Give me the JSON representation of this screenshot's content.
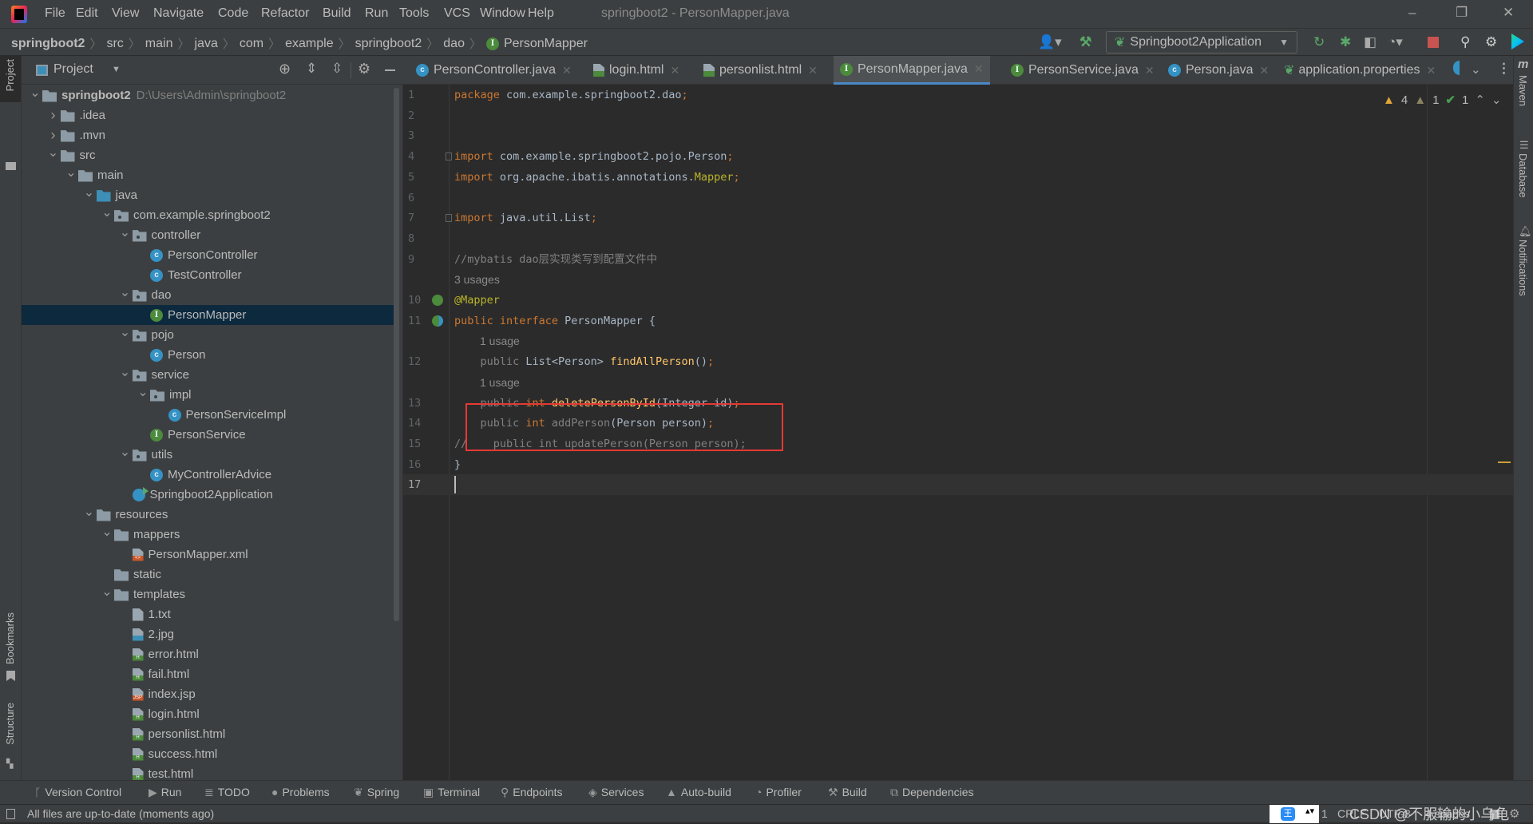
{
  "window": {
    "title": "springboot2 - PersonMapper.java",
    "menu": [
      "File",
      "Edit",
      "View",
      "Navigate",
      "Code",
      "Refactor",
      "Build",
      "Run",
      "Tools",
      "VCS",
      "Window",
      "Help"
    ],
    "controls": {
      "minimize": "–",
      "restore": "❐",
      "close": "✕"
    }
  },
  "breadcrumb": {
    "items": [
      "springboot2",
      "src",
      "main",
      "java",
      "com",
      "example",
      "springboot2",
      "dao"
    ],
    "current": "PersonMapper",
    "current_icon": "interface-icon"
  },
  "toolbar": {
    "run_config": "Springboot2Application",
    "icons": [
      "user-icon",
      "build-hammer-icon",
      "rerun-icon",
      "debug-icon",
      "coverage-icon",
      "profile-icon",
      "stop-icon",
      "search-icon",
      "settings-icon",
      "toolbox-icon"
    ],
    "stop_color": "#c75450"
  },
  "left_stripe": {
    "project": "Project",
    "bookmarks": "Bookmarks",
    "structure": "Structure"
  },
  "right_stripe": {
    "maven": "Maven",
    "database": "Database",
    "notifications": "Notifications"
  },
  "project_panel": {
    "title": "Project",
    "tree": [
      {
        "label": "springboot2",
        "path": "D:\\Users\\Admin\\springboot2",
        "depth": 0,
        "icon": "module",
        "state": "expanded",
        "bold": true
      },
      {
        "label": ".idea",
        "depth": 1,
        "icon": "folder",
        "state": "collapsed"
      },
      {
        "label": ".mvn",
        "depth": 1,
        "icon": "folder",
        "state": "collapsed"
      },
      {
        "label": "src",
        "depth": 1,
        "icon": "folder",
        "state": "expanded"
      },
      {
        "label": "main",
        "depth": 2,
        "icon": "folder",
        "state": "expanded"
      },
      {
        "label": "java",
        "depth": 3,
        "icon": "source-folder",
        "state": "expanded"
      },
      {
        "label": "com.example.springboot2",
        "depth": 4,
        "icon": "package",
        "state": "expanded"
      },
      {
        "label": "controller",
        "depth": 5,
        "icon": "package",
        "state": "expanded"
      },
      {
        "label": "PersonController",
        "depth": 6,
        "icon": "class",
        "state": "leaf"
      },
      {
        "label": "TestController",
        "depth": 6,
        "icon": "class",
        "state": "leaf"
      },
      {
        "label": "dao",
        "depth": 5,
        "icon": "package",
        "state": "expanded"
      },
      {
        "label": "PersonMapper",
        "depth": 6,
        "icon": "interface",
        "state": "leaf",
        "selected": true
      },
      {
        "label": "pojo",
        "depth": 5,
        "icon": "package",
        "state": "expanded"
      },
      {
        "label": "Person",
        "depth": 6,
        "icon": "class",
        "state": "leaf"
      },
      {
        "label": "service",
        "depth": 5,
        "icon": "package",
        "state": "expanded"
      },
      {
        "label": "impl",
        "depth": 6,
        "icon": "package",
        "state": "expanded"
      },
      {
        "label": "PersonServiceImpl",
        "depth": 7,
        "icon": "class",
        "state": "leaf"
      },
      {
        "label": "PersonService",
        "depth": 6,
        "icon": "interface",
        "state": "leaf"
      },
      {
        "label": "utils",
        "depth": 5,
        "icon": "package",
        "state": "expanded"
      },
      {
        "label": "MyControllerAdvice",
        "depth": 6,
        "icon": "class",
        "state": "leaf"
      },
      {
        "label": "Springboot2Application",
        "depth": 5,
        "icon": "spring-boot",
        "state": "leaf"
      },
      {
        "label": "resources",
        "depth": 3,
        "icon": "resources-folder",
        "state": "expanded"
      },
      {
        "label": "mappers",
        "depth": 4,
        "icon": "folder",
        "state": "expanded"
      },
      {
        "label": "PersonMapper.xml",
        "depth": 5,
        "icon": "xml",
        "state": "leaf"
      },
      {
        "label": "static",
        "depth": 4,
        "icon": "folder",
        "state": "leaf"
      },
      {
        "label": "templates",
        "depth": 4,
        "icon": "folder",
        "state": "expanded"
      },
      {
        "label": "1.txt",
        "depth": 5,
        "icon": "text",
        "state": "leaf"
      },
      {
        "label": "2.jpg",
        "depth": 5,
        "icon": "image",
        "state": "leaf"
      },
      {
        "label": "error.html",
        "depth": 5,
        "icon": "html",
        "state": "leaf"
      },
      {
        "label": "fail.html",
        "depth": 5,
        "icon": "html",
        "state": "leaf"
      },
      {
        "label": "index.jsp",
        "depth": 5,
        "icon": "jsp",
        "state": "leaf"
      },
      {
        "label": "login.html",
        "depth": 5,
        "icon": "html",
        "state": "leaf"
      },
      {
        "label": "personlist.html",
        "depth": 5,
        "icon": "html",
        "state": "leaf"
      },
      {
        "label": "success.html",
        "depth": 5,
        "icon": "html",
        "state": "leaf"
      },
      {
        "label": "test.html",
        "depth": 5,
        "icon": "html",
        "state": "leaf"
      }
    ]
  },
  "editor_tabs": [
    {
      "label": "PersonController.java",
      "icon": "class"
    },
    {
      "label": "login.html",
      "icon": "html"
    },
    {
      "label": "personlist.html",
      "icon": "html"
    },
    {
      "label": "PersonMapper.java",
      "icon": "interface",
      "active": true
    },
    {
      "label": "PersonService.java",
      "icon": "interface"
    },
    {
      "label": "Person.java",
      "icon": "class"
    },
    {
      "label": "application.properties",
      "icon": "spring-properties"
    }
  ],
  "inspections": {
    "warnings": "4",
    "weak_warnings": "1",
    "ok": "1"
  },
  "code": [
    {
      "n": "1",
      "t": [
        [
          "package ",
          "kw"
        ],
        [
          "com.example.springboot2.dao",
          "id"
        ],
        [
          ";",
          "kw"
        ]
      ]
    },
    {
      "n": "2",
      "t": []
    },
    {
      "n": "3",
      "t": []
    },
    {
      "n": "4",
      "t": [
        [
          "import ",
          "kw"
        ],
        [
          "com.example.springboot2.pojo.Person",
          "id"
        ],
        [
          ";",
          "kw"
        ]
      ]
    },
    {
      "n": "5",
      "t": [
        [
          "import ",
          "kw"
        ],
        [
          "org.apache.ibatis.annotations.",
          "id"
        ],
        [
          "Mapper",
          "ann"
        ],
        [
          ";",
          "kw"
        ]
      ]
    },
    {
      "n": "6",
      "t": []
    },
    {
      "n": "7",
      "t": [
        [
          "import ",
          "kw"
        ],
        [
          "java.util.List",
          "id"
        ],
        [
          ";",
          "kw"
        ]
      ]
    },
    {
      "n": "8",
      "t": []
    },
    {
      "n": "9",
      "t": [
        [
          "//mybatis dao层实现类写到配置文件中",
          "cm"
        ]
      ]
    },
    {
      "hint": "3 usages"
    },
    {
      "n": "10",
      "t": [
        [
          "@Mapper",
          "ann"
        ]
      ]
    },
    {
      "n": "11",
      "t": [
        [
          "public interface ",
          "kw"
        ],
        [
          "PersonMapper {",
          "id"
        ]
      ]
    },
    {
      "hint": "1 usage",
      "indent": true
    },
    {
      "n": "12",
      "t": [
        [
          "    public ",
          "gr"
        ],
        [
          "List<Person> ",
          "id"
        ],
        [
          "findAllPerson",
          "fn"
        ],
        [
          "()",
          "id"
        ],
        [
          ";",
          "kw"
        ]
      ]
    },
    {
      "hint": "1 usage",
      "indent": true
    },
    {
      "n": "13",
      "t": [
        [
          "    public ",
          "gr"
        ],
        [
          "int ",
          "kw"
        ],
        [
          "deletePersonById",
          "fn"
        ],
        [
          "(Integer id)",
          "id"
        ],
        [
          ";",
          "kw"
        ]
      ]
    },
    {
      "n": "14",
      "t": [
        [
          "    public ",
          "gr"
        ],
        [
          "int ",
          "kw"
        ],
        [
          "addPerson",
          "gr"
        ],
        [
          "(Person person)",
          "id"
        ],
        [
          ";",
          "kw"
        ]
      ]
    },
    {
      "n": "15",
      "t": [
        [
          "//    public int updatePerson(Person person);",
          "cm"
        ]
      ]
    },
    {
      "n": "16",
      "t": [
        [
          "}",
          "id"
        ]
      ]
    },
    {
      "n": "17",
      "t": [],
      "current": true
    }
  ],
  "highlight_box_color": "#e53935",
  "bottom_tools": [
    {
      "label": "Version Control",
      "icon": "vcs-branch-icon",
      "glyph": "ᚴ"
    },
    {
      "label": "Run",
      "icon": "run-icon",
      "glyph": "▶"
    },
    {
      "label": "TODO",
      "icon": "todo-list-icon",
      "glyph": "≣"
    },
    {
      "label": "Problems",
      "icon": "problems-icon",
      "glyph": "●"
    },
    {
      "label": "Spring",
      "icon": "spring-leaf-icon",
      "glyph": "❦"
    },
    {
      "label": "Terminal",
      "icon": "terminal-icon",
      "glyph": "▣"
    },
    {
      "label": "Endpoints",
      "icon": "endpoints-icon",
      "glyph": "⚲"
    },
    {
      "label": "Services",
      "icon": "services-icon",
      "glyph": "◈"
    },
    {
      "label": "Auto-build",
      "icon": "auto-build-icon",
      "glyph": "▲"
    },
    {
      "label": "Profiler",
      "icon": "profiler-icon",
      "glyph": "◔"
    },
    {
      "label": "Build",
      "icon": "build-icon",
      "glyph": "⚒"
    },
    {
      "label": "Dependencies",
      "icon": "dependencies-icon",
      "glyph": "⧉"
    }
  ],
  "status": {
    "message": "All files are up-to-date (moments ago)",
    "position": "1",
    "line_sep": "CRLF",
    "encoding": "UTF-8",
    "indent": "4 spaces",
    "watermark": "CSDN @不服输的小乌龟"
  }
}
